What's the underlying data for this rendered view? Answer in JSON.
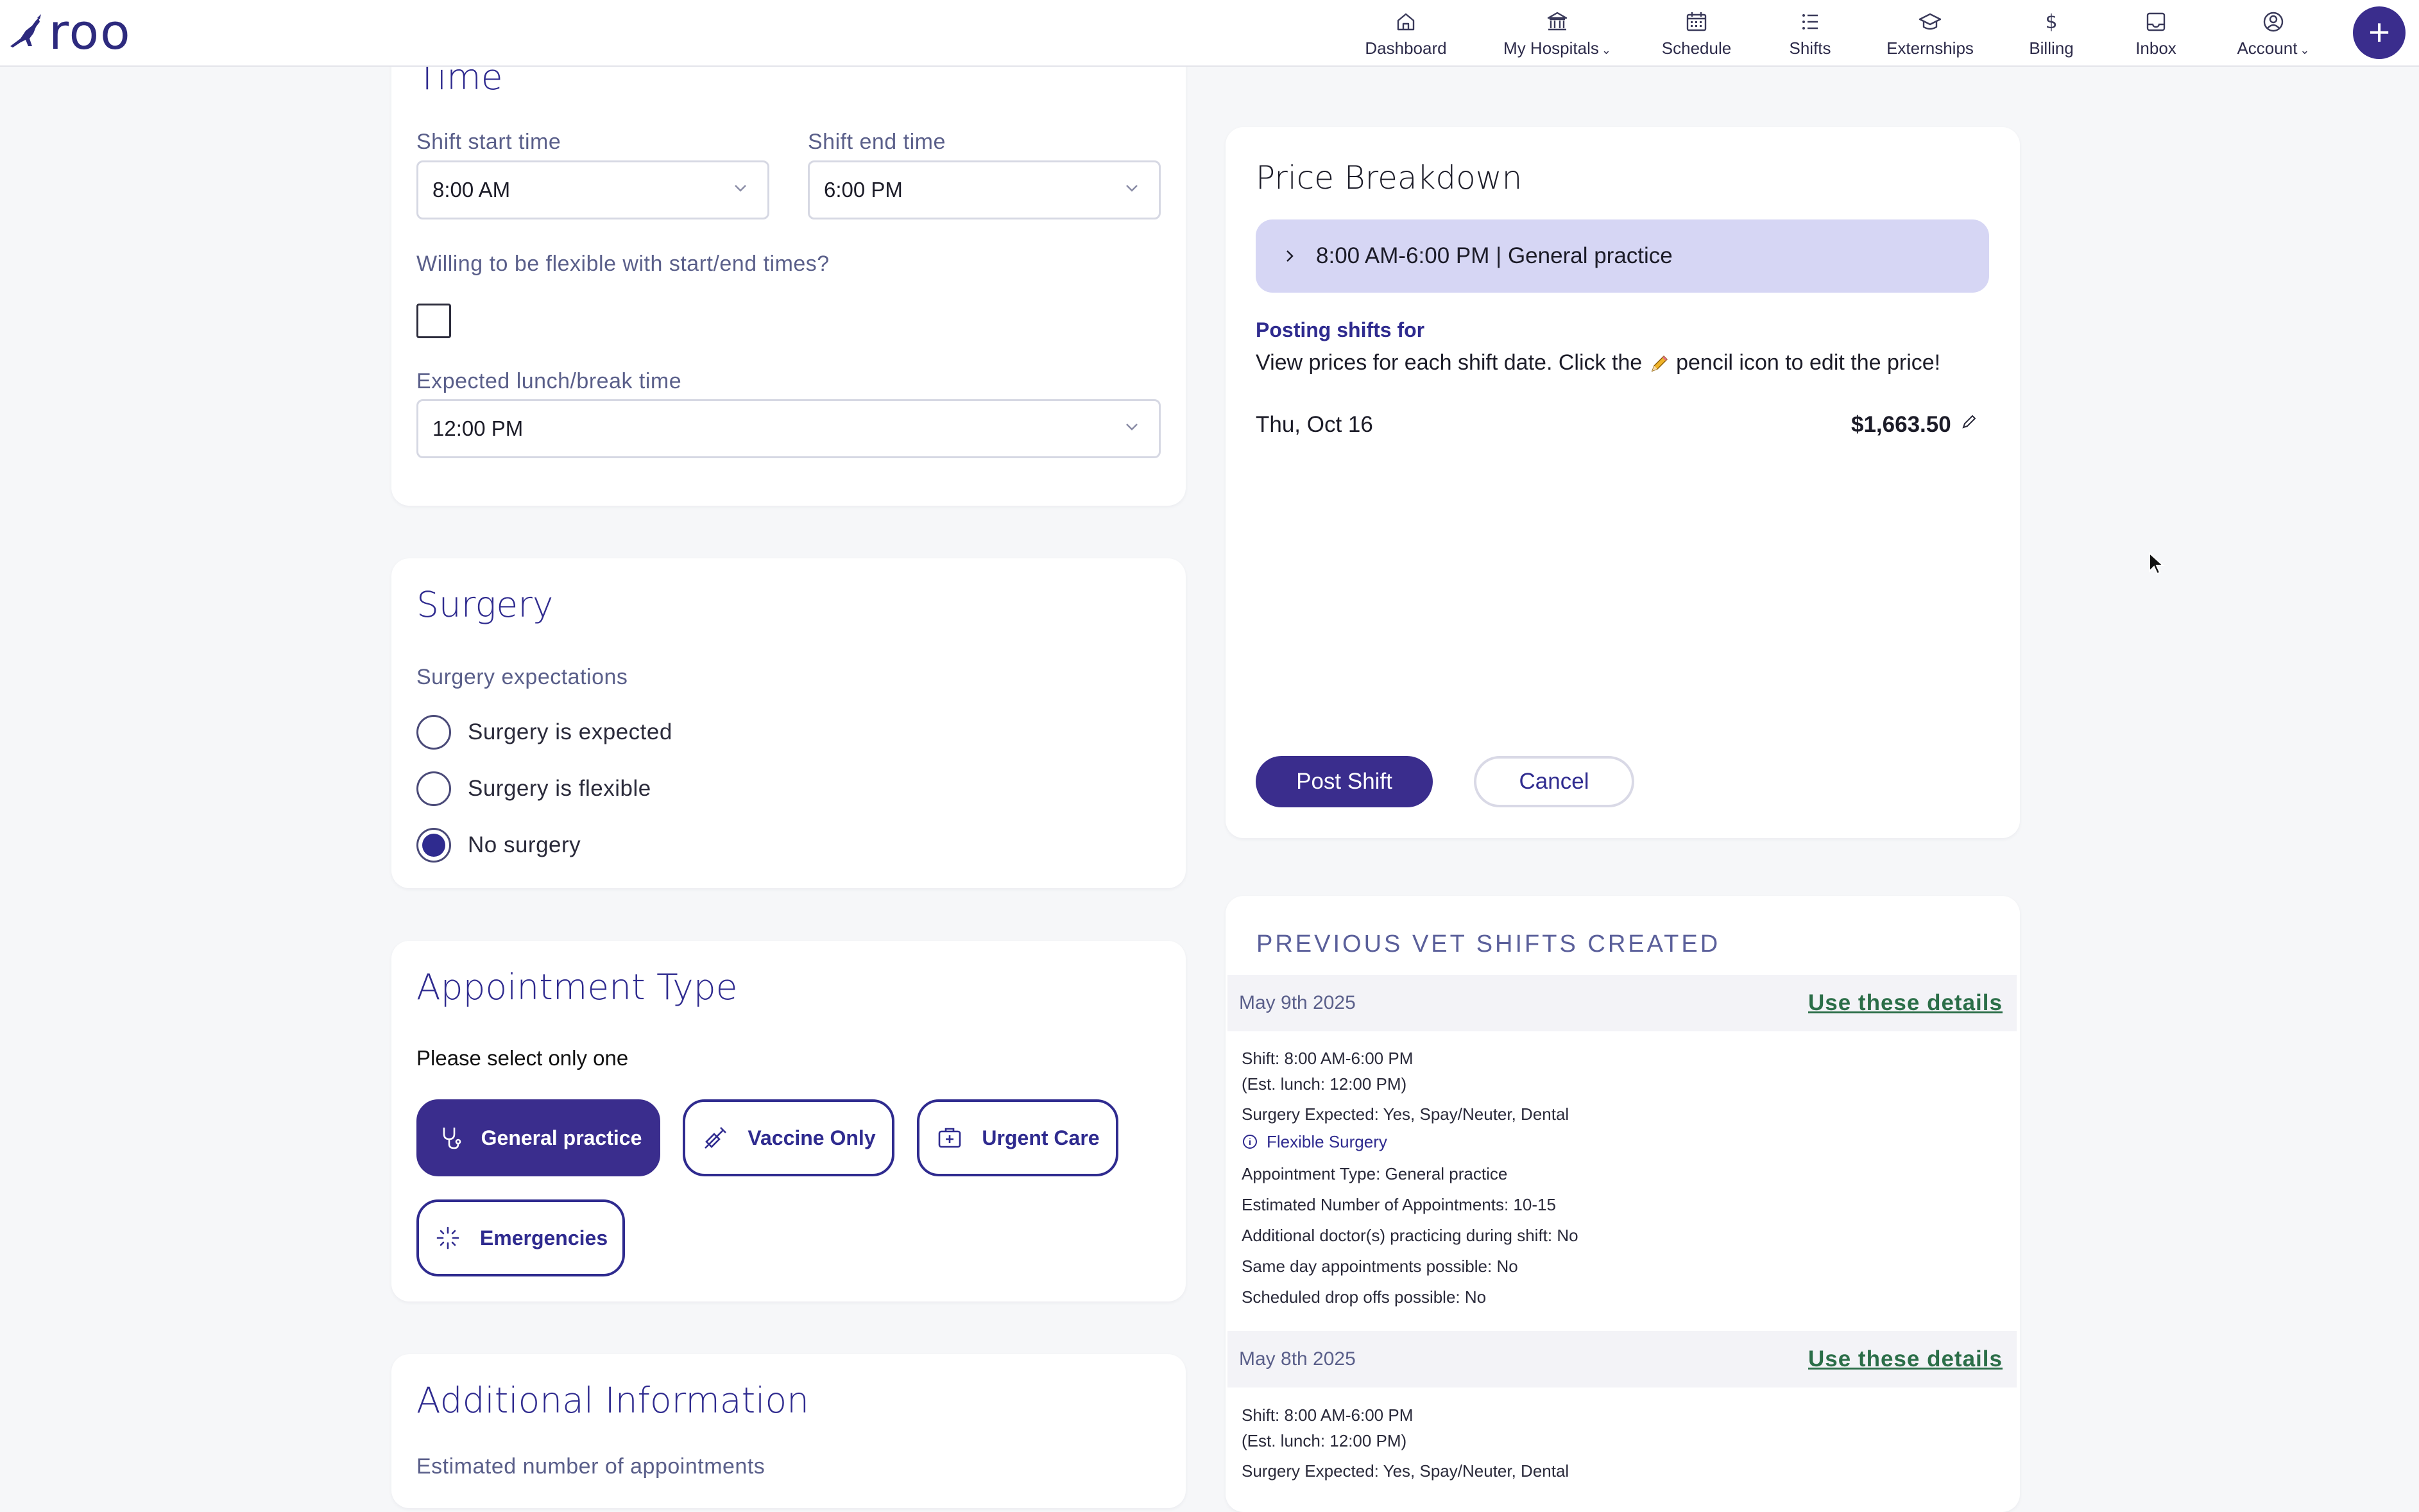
{
  "brand": {
    "name": "roo",
    "color": "#2d2a7e"
  },
  "nav": {
    "items": [
      {
        "label": "Dashboard",
        "icon": "home-icon"
      },
      {
        "label": "My Hospitals",
        "icon": "hospital-icon",
        "dropdown": true
      },
      {
        "label": "Schedule",
        "icon": "calendar-icon"
      },
      {
        "label": "Shifts",
        "icon": "list-icon"
      },
      {
        "label": "Externships",
        "icon": "graduation-cap-icon"
      },
      {
        "label": "Billing",
        "icon": "dollar-icon"
      },
      {
        "label": "Inbox",
        "icon": "inbox-icon"
      },
      {
        "label": "Account",
        "icon": "user-circle-icon",
        "dropdown": true
      }
    ],
    "add_label": "+"
  },
  "time_section": {
    "title": "Time",
    "start_label": "Shift start time",
    "start_value": "8:00 AM",
    "end_label": "Shift end time",
    "end_value": "6:00 PM",
    "flexible_label": "Willing to be flexible with start/end times?",
    "lunch_label": "Expected lunch/break time",
    "lunch_value": "12:00 PM"
  },
  "surgery_section": {
    "title": "Surgery",
    "label": "Surgery expectations",
    "options": [
      {
        "label": "Surgery is expected",
        "checked": false
      },
      {
        "label": "Surgery is flexible",
        "checked": false
      },
      {
        "label": "No surgery",
        "checked": true
      }
    ]
  },
  "appointment_section": {
    "title": "Appointment Type",
    "note": "Please select only one",
    "options": [
      {
        "label": "General practice",
        "icon": "stethoscope-icon",
        "active": true
      },
      {
        "label": "Vaccine Only",
        "icon": "syringe-icon",
        "active": false
      },
      {
        "label": "Urgent Care",
        "icon": "first-aid-icon",
        "active": false
      },
      {
        "label": "Emergencies",
        "icon": "emergency-sparkle-icon",
        "active": false
      }
    ]
  },
  "additional_section": {
    "title": "Additional Information",
    "cut_label": "Estimated number of appointments"
  },
  "price": {
    "title": "Price Breakdown",
    "accordion_label": "8:00 AM-6:00 PM |  General practice",
    "posting_for": "Posting shifts for",
    "desc_before": "View prices for each shift date. Click the ",
    "desc_after": " pencil icon to edit the price!",
    "date": "Thu, Oct 16",
    "amount": "$1,663.50",
    "post_label": "Post Shift",
    "cancel_label": "Cancel"
  },
  "previous": {
    "title": "PREVIOUS VET SHIFTS CREATED",
    "entries": [
      {
        "date": "May 9th 2025",
        "link": "Use these details",
        "shift": "Shift: 8:00 AM-6:00 PM",
        "lunch": "(Est. lunch: 12:00 PM)",
        "surgery": "Surgery Expected: Yes, Spay/Neuter, Dental",
        "flexible": "Flexible Surgery",
        "appointment": "Appointment Type: General practice",
        "estimated": "Estimated Number of Appointments: 10-15",
        "additional": "Additional doctor(s) practicing during shift: No",
        "same_day": "Same day appointments possible: No",
        "drop_offs": "Scheduled drop offs possible: No"
      },
      {
        "date": "May 8th 2025",
        "link": "Use these details",
        "shift": "Shift: 8:00 AM-6:00 PM",
        "lunch": "(Est. lunch: 12:00 PM)",
        "surgery": "Surgery Expected: Yes, Spay/Neuter, Dental"
      }
    ]
  },
  "colors": {
    "primary": "#3a2d8d",
    "heading": "#2f2b8f",
    "accordion": "#d6d6f4",
    "link": "#2b6e48",
    "background": "#f6f7f9"
  }
}
